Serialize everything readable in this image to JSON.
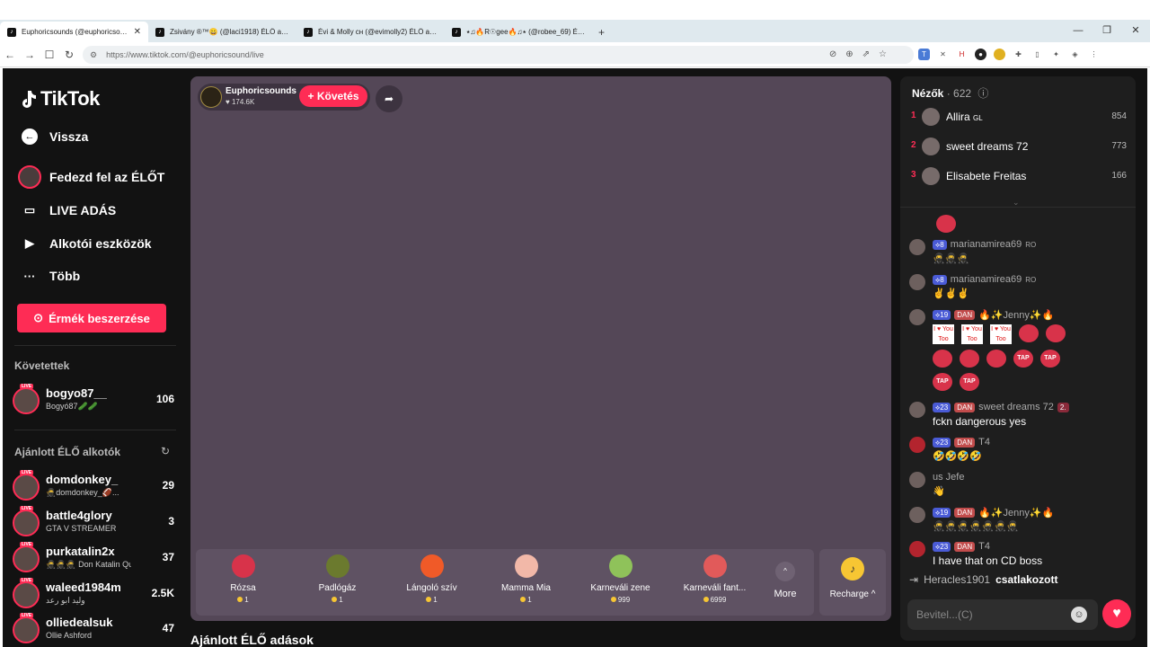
{
  "browser": {
    "tabs": [
      {
        "title": "Euphoricsounds (@euphoricsoun..."
      },
      {
        "title": "Zsivány ®™😀 (@laci1918) ÉLŐ adás..."
      },
      {
        "title": "Évi & Molly ᴄʜ (@evimolly2) ÉLŐ adá..."
      },
      {
        "title": "⭑♫🔥R☉gee🔥♫⭑ (@robee_69) ÉLŐ ..."
      }
    ],
    "url": "https://www.tiktok.com/@euphoricsound/live",
    "new_tab": "+",
    "win_min": "—",
    "win_max": "❐",
    "win_close": "✕"
  },
  "sidebar": {
    "logo": "TikTok",
    "back": "Vissza",
    "explore": "Fedezd fel az ÉLŐT",
    "live": "LIVE ADÁS",
    "creator_tools": "Alkotói eszközök",
    "more": "Több",
    "coins_button": "Érmék beszerzése",
    "following_title": "Követettek",
    "following": [
      {
        "name": "bogyo87__",
        "sub": "Bogyó87🥒🥒",
        "count": "106"
      }
    ],
    "recommended_title": "Ajánlott ÉLŐ alkotók",
    "recommended": [
      {
        "name": "domdonkey_",
        "sub": "🥷domdonkey_🏈...",
        "count": "29"
      },
      {
        "name": "battle4glory",
        "sub": "GTA V STREAMER",
        "count": "3"
      },
      {
        "name": "purkatalin2x",
        "sub": "🥷🥷🥷 Don Katalin Qu...",
        "count": "37"
      },
      {
        "name": "waleed1984m",
        "sub": "وليد ابو رعد",
        "count": "2.5K"
      },
      {
        "name": "olliedealsuk",
        "sub": "Ollie Ashford",
        "count": "47"
      }
    ],
    "live_badge": "LIVE"
  },
  "stream": {
    "host_name": "Euphoricsounds",
    "likes": "♥ 174.6K",
    "follow_button": "+ Követés",
    "gifts": [
      {
        "name": "Rózsa",
        "price": "1",
        "color": "#d8334a"
      },
      {
        "name": "Padlógáz",
        "price": "1",
        "color": "#6b7a2e"
      },
      {
        "name": "Lángoló szív",
        "price": "1",
        "color": "#f05a28"
      },
      {
        "name": "Mamma Mia",
        "price": "1",
        "color": "#f2b8a8"
      },
      {
        "name": "Karneváli zene",
        "price": "999",
        "color": "#8fc25a"
      },
      {
        "name": "Karneváli fant...",
        "price": "6999",
        "color": "#e15a5a"
      }
    ],
    "more_label": "More",
    "recharge_label": "Recharge ^",
    "suggested_title": "Ajánlott ÉLŐ adások"
  },
  "chat": {
    "viewers_label": "Nézők",
    "viewers_count": "· 622",
    "top": [
      {
        "rank": "1",
        "name": "Allira",
        "tag": "GL",
        "score": "854"
      },
      {
        "rank": "2",
        "name": "sweet dreams 72",
        "tag": "",
        "score": "773"
      },
      {
        "rank": "3",
        "name": "Elisabete Freitas",
        "tag": "",
        "score": "166"
      }
    ],
    "messages": [
      {
        "level": "8",
        "dan": "",
        "user": "marianamirea69",
        "tag": "RO",
        "text": "🥷🥷🥷"
      },
      {
        "level": "8",
        "dan": "",
        "user": "marianamirea69",
        "tag": "RO",
        "text": "✌✌✌"
      },
      {
        "level": "19",
        "dan": "DAN",
        "user": "🔥✨Jenny✨🔥",
        "tag": "",
        "text": ""
      },
      {
        "level": "23",
        "dan": "DAN",
        "user": "sweet dreams 72",
        "tag": "2.",
        "text": "fckn dangerous yes"
      },
      {
        "level": "23",
        "dan": "DAN",
        "user": "T4",
        "tag": "",
        "text": "🤣🤣🤣🤣"
      },
      {
        "level": "",
        "dan": "",
        "user": "us Jefe",
        "tag": "",
        "text": "👋"
      },
      {
        "level": "19",
        "dan": "DAN",
        "user": "🔥✨Jenny✨🔥",
        "tag": "",
        "text": "🥷🥷🥷🥷🥷🥷🥷"
      },
      {
        "level": "23",
        "dan": "DAN",
        "user": "T4",
        "tag": "",
        "text": "I have that on CD boss"
      }
    ],
    "sticker_text": "I ♥ You Too",
    "tap_text": "TAP",
    "joined_user": "Heracles1901",
    "joined_text": "csatlakozott",
    "input_placeholder": "Bevitel...(C)"
  }
}
